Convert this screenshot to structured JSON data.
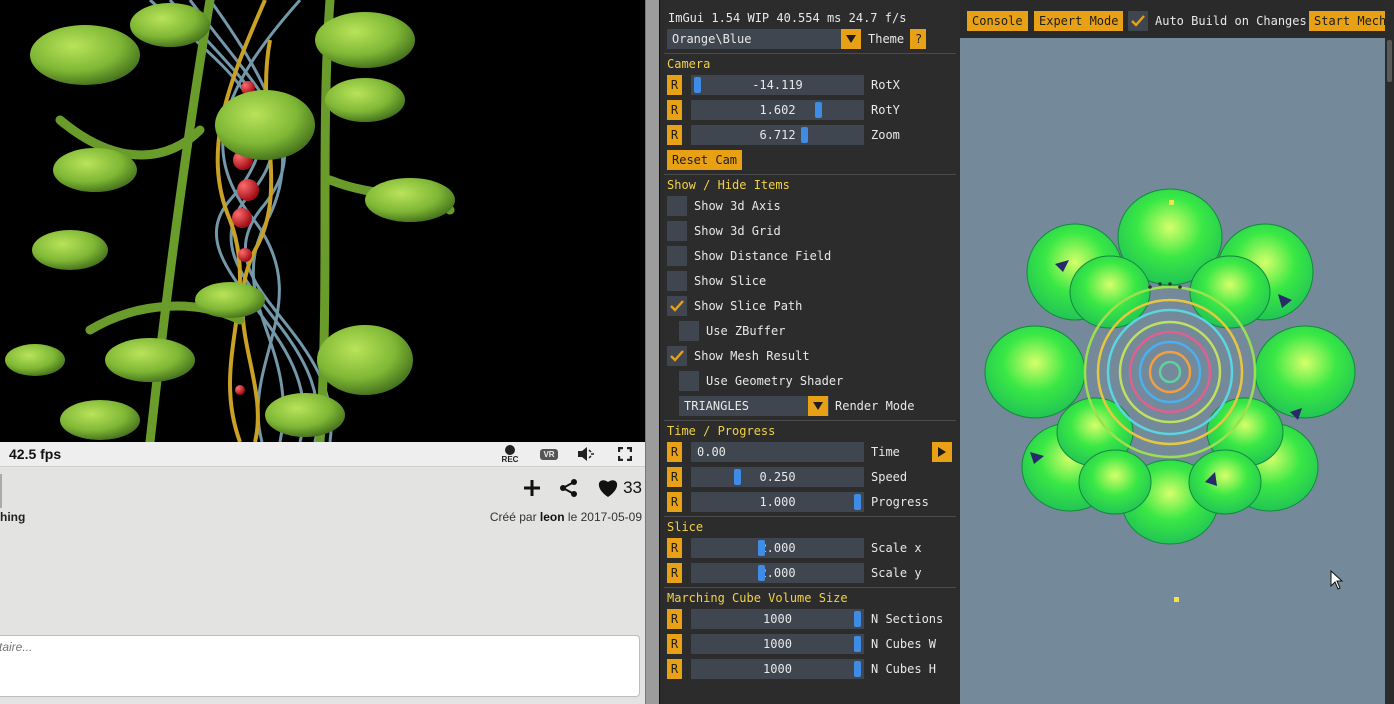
{
  "player": {
    "fps": "42.5 fps",
    "rec_label": "REC",
    "vr_label": "VR"
  },
  "shader_info": {
    "title_fragment": "hing",
    "created_prefix": "Créé par",
    "author": "leon",
    "created_mid": "le",
    "date": "2017-05-09",
    "likes": "33",
    "comment_placeholder": "taire..."
  },
  "imgui": {
    "header": "ImGui 1.54 WIP 40.554 ms 24.7 f/s",
    "theme": {
      "value": "Orange\\Blue",
      "label": "Theme",
      "help": "?"
    },
    "camera": {
      "title": "Camera",
      "reset_btn": "R",
      "rows": [
        {
          "value": "-14.119",
          "label": "RotX"
        },
        {
          "value": "1.602",
          "label": "RotY"
        },
        {
          "value": "6.712",
          "label": "Zoom"
        }
      ],
      "reset_cam": "Reset Cam"
    },
    "show_hide": {
      "title": "Show / Hide Items",
      "items": [
        {
          "label": "Show 3d Axis",
          "checked": false
        },
        {
          "label": "Show 3d Grid",
          "checked": false
        },
        {
          "label": "Show Distance Field",
          "checked": false
        },
        {
          "label": "Show Slice",
          "checked": false
        },
        {
          "label": "Show Slice Path",
          "checked": true
        },
        {
          "label": "Use ZBuffer",
          "checked": false
        },
        {
          "label": "Show Mesh Result",
          "checked": true
        },
        {
          "label": "Use Geometry Shader",
          "checked": false
        }
      ],
      "render_mode": {
        "value": "TRIANGLES",
        "label": "Render Mode"
      }
    },
    "time": {
      "title": "Time / Progress",
      "rows": [
        {
          "value": "0.00",
          "label": "Time"
        },
        {
          "value": "0.250",
          "label": "Speed"
        },
        {
          "value": "1.000",
          "label": "Progress"
        }
      ]
    },
    "slice": {
      "title": "Slice",
      "rows": [
        {
          "value": "2.000",
          "label": "Scale x"
        },
        {
          "value": "2.000",
          "label": "Scale y"
        }
      ]
    },
    "marching": {
      "title": "Marching Cube Volume Size",
      "rows": [
        {
          "value": "1000",
          "label": "N Sections"
        },
        {
          "value": "1000",
          "label": "N Cubes W"
        },
        {
          "value": "1000",
          "label": "N Cubes H"
        }
      ]
    }
  },
  "toolbar": {
    "console": "Console",
    "expert": "Expert Mode",
    "auto_build": "Auto Build on Changes",
    "auto_build_checked": true,
    "start": "Start Mech"
  },
  "colors": {
    "accent_orange": "#e8a015",
    "section_header": "#f2d243",
    "slider_grab": "#3f8ce6",
    "frame_bg": "#3f4650",
    "panel_bg": "#2c2c2c",
    "view_bg": "#74899a"
  }
}
